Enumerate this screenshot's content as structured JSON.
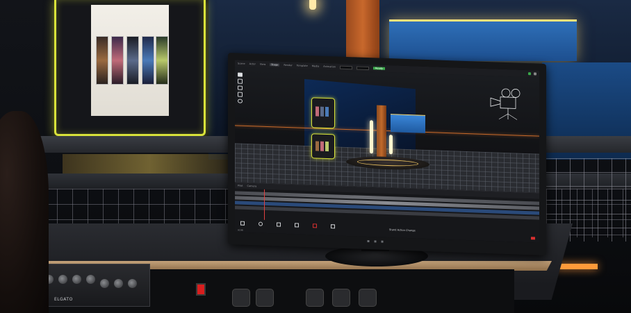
{
  "app": {
    "menubar": {
      "items": [
        "Scene",
        "Actor",
        "View",
        "Stage",
        "Render",
        "Template",
        "Media",
        "Animation"
      ],
      "active_index": 3,
      "ready_label": "Ready"
    },
    "viewport": {
      "tools": [
        "select",
        "move",
        "rotate",
        "scale",
        "focus"
      ],
      "selected_tool": 0
    },
    "timeline": {
      "header_items": [
        "Pilot",
        "Camera"
      ],
      "clip_labels": [
        "Stand Action Change"
      ],
      "transport": [
        "rewind",
        "play",
        "stop",
        "loop",
        "record",
        "forward"
      ]
    },
    "output_label": "HDMI"
  },
  "hardware": {
    "brand": "ELGATO"
  },
  "colors": {
    "accent_yellow": "#d9e23a",
    "accent_orange": "#c8682c",
    "accent_blue": "#2e6fb8",
    "ready_green": "#3aa84a",
    "alert_red": "#d81e1e"
  }
}
